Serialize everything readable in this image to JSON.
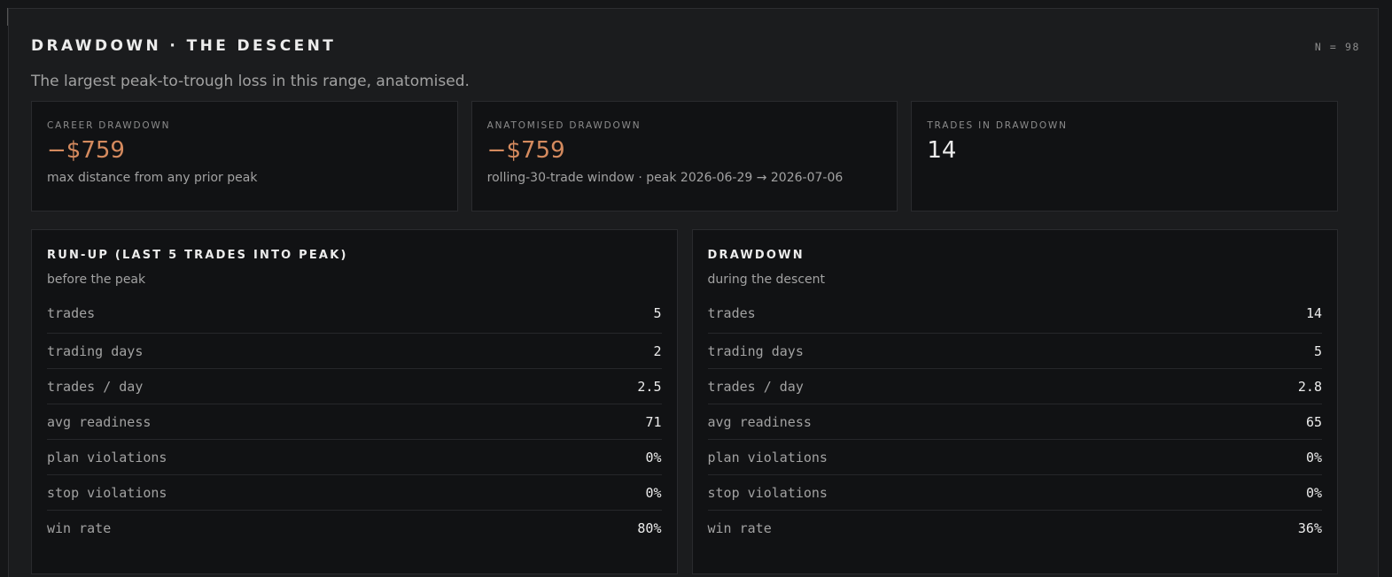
{
  "header": {
    "title": "DRAWDOWN · THE DESCENT",
    "n_count": "N = 98",
    "subtitle": "The largest peak-to-trough loss in this range, anatomised."
  },
  "cards": [
    {
      "label": "CAREER DRAWDOWN",
      "value": "−$759",
      "note": "max distance from any prior peak",
      "value_color": "#d48a5e"
    },
    {
      "label": "ANATOMISED DRAWDOWN",
      "value": "−$759",
      "note": "rolling-30-trade window · peak 2026-06-29 → 2026-07-06",
      "value_color": "#d48a5e"
    },
    {
      "label": "TRADES IN DRAWDOWN",
      "value": "14",
      "note": ""
    }
  ],
  "runup": {
    "title": "RUN-UP (LAST 5 TRADES INTO PEAK)",
    "subtitle": "before the peak",
    "rows": [
      {
        "label": "trades",
        "value": "5"
      },
      {
        "label": "trading days",
        "value": "2"
      },
      {
        "label": "trades / day",
        "value": "2.5"
      },
      {
        "label": "avg readiness",
        "value": "71"
      },
      {
        "label": "plan violations",
        "value": "0%"
      },
      {
        "label": "stop violations",
        "value": "0%"
      },
      {
        "label": "win rate",
        "value": "80%"
      }
    ]
  },
  "drawdown": {
    "title": "DRAWDOWN",
    "subtitle": "during the descent",
    "rows": [
      {
        "label": "trades",
        "value": "14"
      },
      {
        "label": "trading days",
        "value": "5"
      },
      {
        "label": "trades / day",
        "value": "2.8"
      },
      {
        "label": "avg readiness",
        "value": "65"
      },
      {
        "label": "plan violations",
        "value": "0%"
      },
      {
        "label": "stop violations",
        "value": "0%"
      },
      {
        "label": "win rate",
        "value": "36%"
      }
    ]
  },
  "colors": {
    "accent_loss": "#d48a5e",
    "background": "#1b1c1e",
    "card_background": "#111214"
  }
}
